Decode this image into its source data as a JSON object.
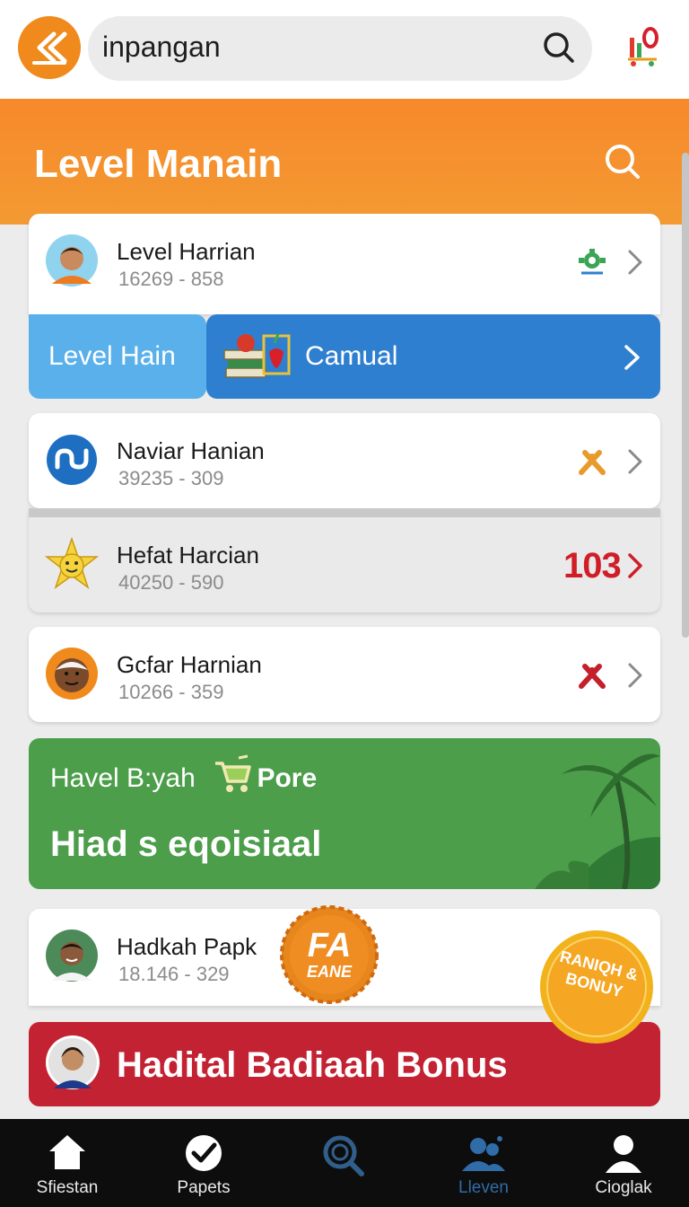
{
  "search": {
    "value": "inpangan"
  },
  "header": {
    "title": "Level Manain"
  },
  "cards": [
    {
      "name": "Level Harrian",
      "meta": "16269 - 858"
    },
    {
      "name": "Naviar Hanian",
      "meta": "39235 - 309"
    },
    {
      "name": "Hefat Harcian",
      "meta": "40250 - 590",
      "count": "103"
    },
    {
      "name": "Gcfar Harnian",
      "meta": "10266 - 359"
    },
    {
      "name": "Hadkah Papk",
      "meta": "18.146 - 329"
    }
  ],
  "category_row": {
    "left_label": "Level Hain",
    "right_label": "Camual"
  },
  "promo": {
    "subtitle_plain": "Havel B:yah",
    "subtitle_bold": "Pore",
    "title": "Hiad s eqoisiaal"
  },
  "fa_badge": {
    "line1": "FA",
    "line2": "EANE"
  },
  "bonus_badge": {
    "text": "RANIQH & BONUY"
  },
  "bonus_banner": {
    "label": "Hadital Badiaah Bonus"
  },
  "bottom_nav": [
    {
      "label": "Sfiestan",
      "icon": "home-icon"
    },
    {
      "label": "Papets",
      "icon": "check-circle-icon"
    },
    {
      "label": "",
      "icon": "search-icon"
    },
    {
      "label": "Lleven",
      "icon": "people-icon"
    },
    {
      "label": "Cioglak",
      "icon": "profile-icon"
    }
  ],
  "colors": {
    "accent": "#f08a1c",
    "blue": "#2f7fd0",
    "light_blue": "#5ab0ea",
    "green": "#4c9e4b",
    "red": "#c32233",
    "nav_bg": "#0d0d0d"
  }
}
